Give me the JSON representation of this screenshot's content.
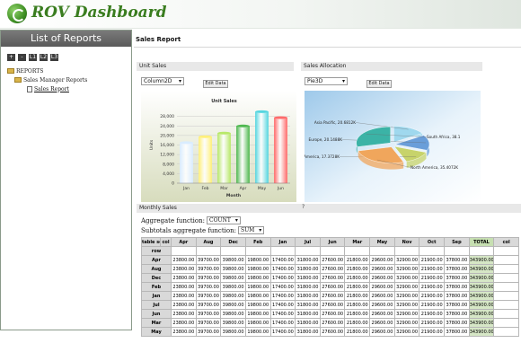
{
  "header": {
    "app_title": "ROV Dashboard"
  },
  "left_panel": {
    "title": "List of Reports",
    "toolbar": [
      "+",
      "-",
      "L1",
      "L2",
      "L3"
    ],
    "tree": {
      "root": "REPORTS",
      "folder": "Sales Manager Reports",
      "report": "Sales Report"
    }
  },
  "main": {
    "title": "Sales Report",
    "unit_sales": {
      "header": "Unit Sales",
      "chart_type": "Column2D",
      "button": "Edit Data",
      "chart_data": {
        "type": "bar",
        "title": "Unit Sales",
        "xlabel": "Month",
        "ylabel": "Units",
        "categories": [
          "Jan",
          "Feb",
          "Mar",
          "Apr",
          "May",
          "Jun"
        ],
        "values": [
          17000,
          19500,
          21000,
          24000,
          30000,
          27500
        ],
        "ylim": [
          0,
          32000
        ],
        "ticks": [
          0,
          4000,
          8000,
          12000,
          16000,
          20000,
          24000,
          28000
        ],
        "tick_labels": [
          "0",
          "4,000",
          "8,000",
          "12,000",
          "16,000",
          "20,000",
          "24,000",
          "28,000"
        ],
        "colors": [
          "#d9ecff",
          "#fff07a",
          "#b8e86a",
          "#4fb84f",
          "#56d6e0",
          "#ff6b6b"
        ]
      }
    },
    "sales_allocation": {
      "header": "Sales Allocation",
      "chart_type": "Pie3D",
      "button": "Edit Data",
      "chart_data": {
        "type": "pie",
        "categories": [
          "Asia Pacific",
          "Europe",
          "America",
          "North America",
          "South Africa"
        ],
        "labels": [
          "Asia Pacific, 20.6812K",
          "Europe, 20.1488K",
          "America, 17.3728K",
          "North America, 35.4072K",
          "South Africa, 38.1"
        ],
        "values": [
          20681.2,
          20148.8,
          17372.8,
          35407.2,
          38100
        ],
        "colors": [
          "#9fd8ee",
          "#6a9ed9",
          "#c7d36b",
          "#f0a65c",
          "#3bb3a6"
        ]
      }
    },
    "monthly_sales": {
      "header": "Monthly Sales",
      "help": "?",
      "aggregate_label": "Aggregate function:",
      "aggregate_value": "COUNT",
      "subtotals_label": "Subtotals aggregate function:",
      "subtotals_value": "SUM",
      "table": {
        "corner_labels": [
          "table set",
          "col"
        ],
        "row_label": "row",
        "columns": [
          "Apr",
          "Aug",
          "Dec",
          "Feb",
          "Jan",
          "Jul",
          "Jun",
          "Mar",
          "May",
          "Nov",
          "Oct",
          "Sep",
          "TOTAL",
          "col"
        ],
        "rows": [
          {
            "name": "Apr",
            "cells": [
              "23800.00",
              "39700.00",
              "39800.00",
              "19800.00",
              "17400.00",
              "31800.00",
              "27600.00",
              "21800.00",
              "29600.00",
              "32900.00",
              "21900.00",
              "37800.00",
              "343900.00"
            ]
          },
          {
            "name": "Aug",
            "cells": [
              "23800.00",
              "39700.00",
              "39800.00",
              "19800.00",
              "17400.00",
              "31800.00",
              "27600.00",
              "21800.00",
              "29600.00",
              "32900.00",
              "21900.00",
              "37800.00",
              "343900.00"
            ]
          },
          {
            "name": "Dec",
            "cells": [
              "23800.00",
              "39700.00",
              "39800.00",
              "19800.00",
              "17400.00",
              "31800.00",
              "27600.00",
              "21800.00",
              "29600.00",
              "32900.00",
              "21900.00",
              "37800.00",
              "343900.00"
            ]
          },
          {
            "name": "Feb",
            "cells": [
              "23800.00",
              "39700.00",
              "39800.00",
              "19800.00",
              "17400.00",
              "31800.00",
              "27600.00",
              "21800.00",
              "29600.00",
              "32900.00",
              "21900.00",
              "37800.00",
              "343900.00"
            ]
          },
          {
            "name": "Jan",
            "cells": [
              "23800.00",
              "39700.00",
              "39800.00",
              "19800.00",
              "17400.00",
              "31800.00",
              "27600.00",
              "21800.00",
              "29600.00",
              "32900.00",
              "21900.00",
              "37800.00",
              "343900.00"
            ]
          },
          {
            "name": "Jul",
            "cells": [
              "23800.00",
              "39700.00",
              "39800.00",
              "19800.00",
              "17400.00",
              "31800.00",
              "27600.00",
              "21800.00",
              "29600.00",
              "32900.00",
              "21900.00",
              "37800.00",
              "343900.00"
            ]
          },
          {
            "name": "Jun",
            "cells": [
              "23800.00",
              "39700.00",
              "39800.00",
              "19800.00",
              "17400.00",
              "31800.00",
              "27600.00",
              "21800.00",
              "29600.00",
              "32900.00",
              "21900.00",
              "37800.00",
              "343900.00"
            ]
          },
          {
            "name": "Mar",
            "cells": [
              "23800.00",
              "39700.00",
              "39800.00",
              "19800.00",
              "17400.00",
              "31800.00",
              "27600.00",
              "21800.00",
              "29600.00",
              "32900.00",
              "21900.00",
              "37800.00",
              "343900.00"
            ]
          },
          {
            "name": "May",
            "cells": [
              "23800.00",
              "39700.00",
              "39800.00",
              "19800.00",
              "17400.00",
              "31800.00",
              "27600.00",
              "21800.00",
              "29600.00",
              "32900.00",
              "21900.00",
              "37800.00",
              "343900.00"
            ]
          }
        ]
      }
    }
  }
}
